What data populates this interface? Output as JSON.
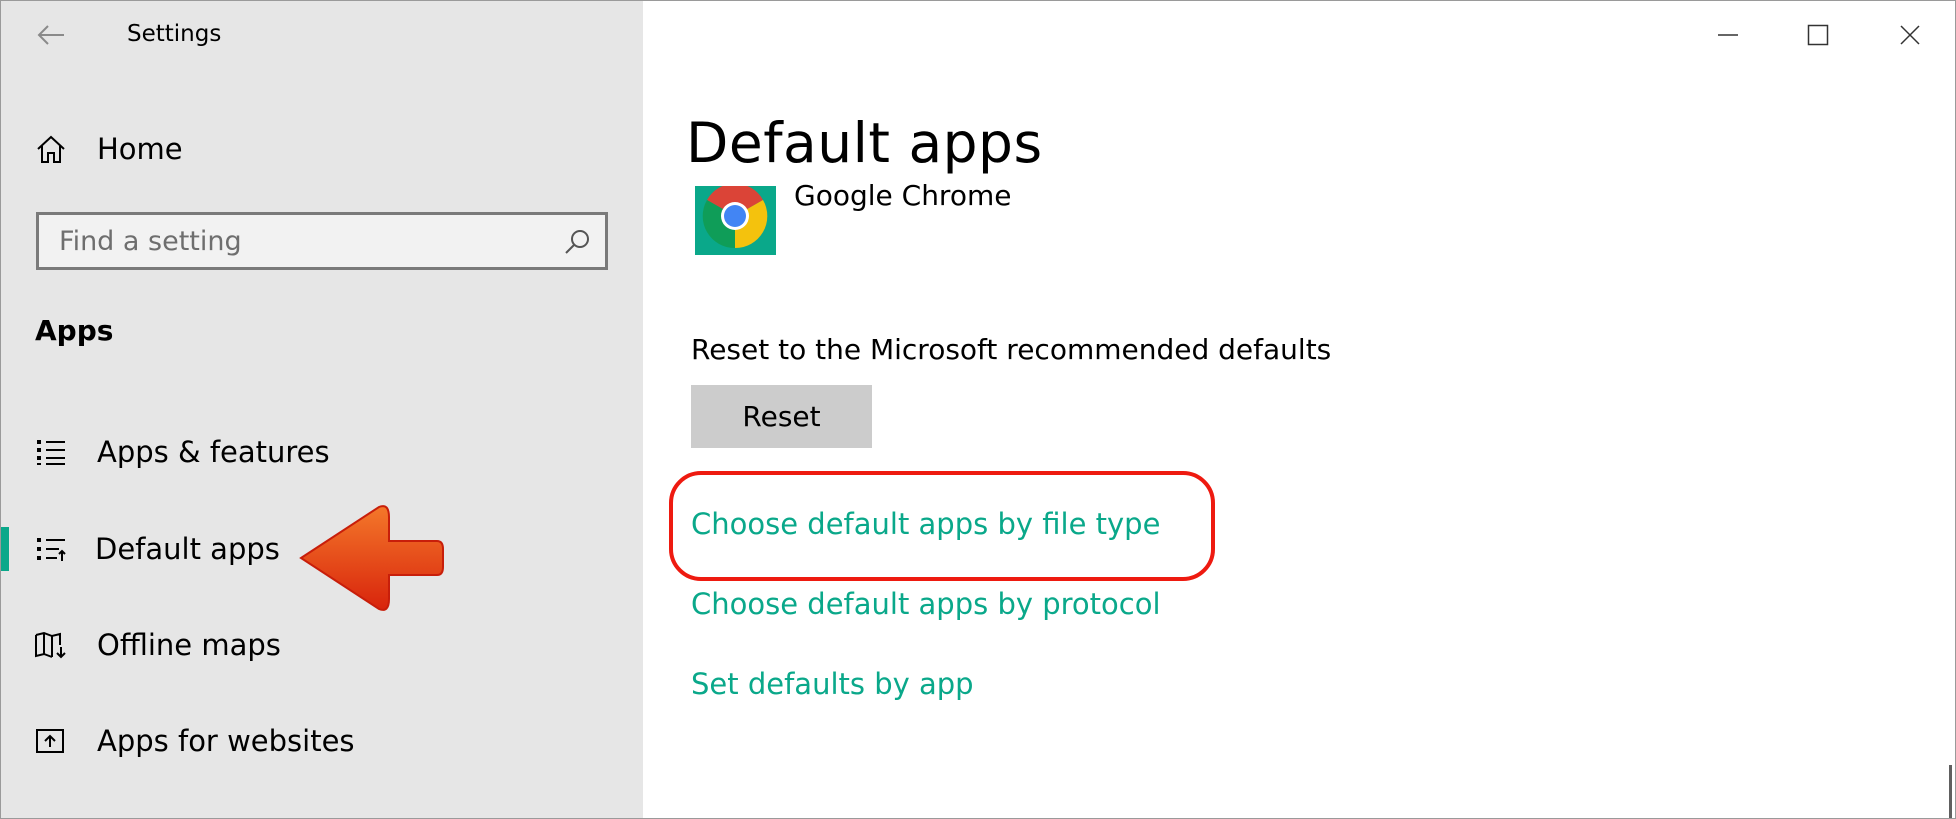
{
  "window": {
    "title": "Settings",
    "controls": {
      "minimize": "minimize-icon",
      "maximize": "maximize-icon",
      "close": "close-icon"
    }
  },
  "sidebar": {
    "home_label": "Home",
    "search": {
      "placeholder": "Find a setting",
      "value": ""
    },
    "section_title": "Apps",
    "items": [
      {
        "label": "Apps & features",
        "icon": "apps-list-icon",
        "selected": false
      },
      {
        "label": "Default apps",
        "icon": "default-apps-icon",
        "selected": true
      },
      {
        "label": "Offline maps",
        "icon": "map-download-icon",
        "selected": false
      },
      {
        "label": "Apps for websites",
        "icon": "open-in-app-icon",
        "selected": false
      }
    ]
  },
  "main": {
    "title": "Default apps",
    "web_browser": {
      "app_name": "Google Chrome",
      "icon": "chrome-icon"
    },
    "reset": {
      "description": "Reset to the Microsoft recommended defaults",
      "button_label": "Reset"
    },
    "links": [
      "Choose default apps by file type",
      "Choose default apps by protocol",
      "Set defaults by app"
    ]
  },
  "colors": {
    "accent": "#0aa88a",
    "sidebar_bg": "#e6e6e6",
    "annotation_red": "#ee1a10"
  }
}
